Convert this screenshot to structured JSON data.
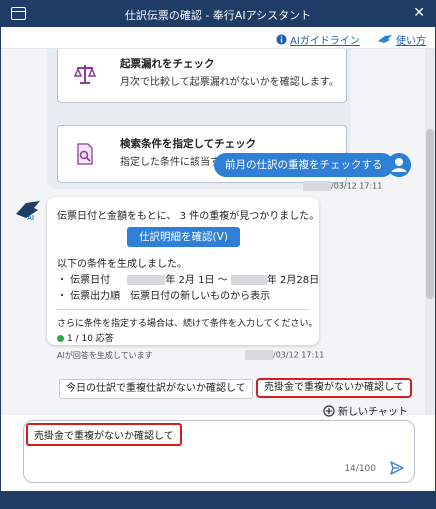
{
  "window": {
    "title": "仕訳伝票の確認 - 奉行AIアシスタント",
    "close_glyph": "✕"
  },
  "toolbar": {
    "guideline_label": "AIガイドライン",
    "howto_label": "使い方"
  },
  "options": [
    {
      "title": "起票漏れをチェック",
      "description": "月次で比較して起票漏れがないかを確認します。",
      "icon": "scale-icon"
    },
    {
      "title": "検索条件を指定してチェック",
      "description": "指定した条件に該当する仕訳伝票を確認します。",
      "icon": "document-search-icon"
    }
  ],
  "user_message": {
    "text": "前月の仕訳の重複をチェックする",
    "timestamp": "/03/12 17:11"
  },
  "bot_message": {
    "summary": "伝票日付と金額をもとに、 3 件の重複が見つかりました。",
    "button_label": "仕訳明細を確認(V)",
    "conditions_intro": "以下の条件を生成しました。",
    "condition_date_label": "・ 伝票日付",
    "condition_date_from": "年 2月 1日 ～",
    "condition_date_to": "年 2月28日",
    "condition_order": "・ 伝票出力順　伝票日付の新しいものから表示",
    "followup": "さらに条件を指定する場合は、続けて条件を入力してください。",
    "response_count": "1 / 10 応答",
    "disclaimer": "AIが回答を生成しています",
    "timestamp": "/03/12 17:11"
  },
  "suggestions": [
    "今日の仕訳で重複仕訳がないか確認して",
    "売掛金で重複がないか確認して"
  ],
  "new_chat_label": "新しいチャット",
  "input": {
    "value": "売掛金で重複がないか確認して",
    "counter": "14/100"
  },
  "colors": {
    "navy": "#1e3c66",
    "accent": "#2f7fd6",
    "highlight": "#d51f1f",
    "status_green": "#2aa84a"
  }
}
